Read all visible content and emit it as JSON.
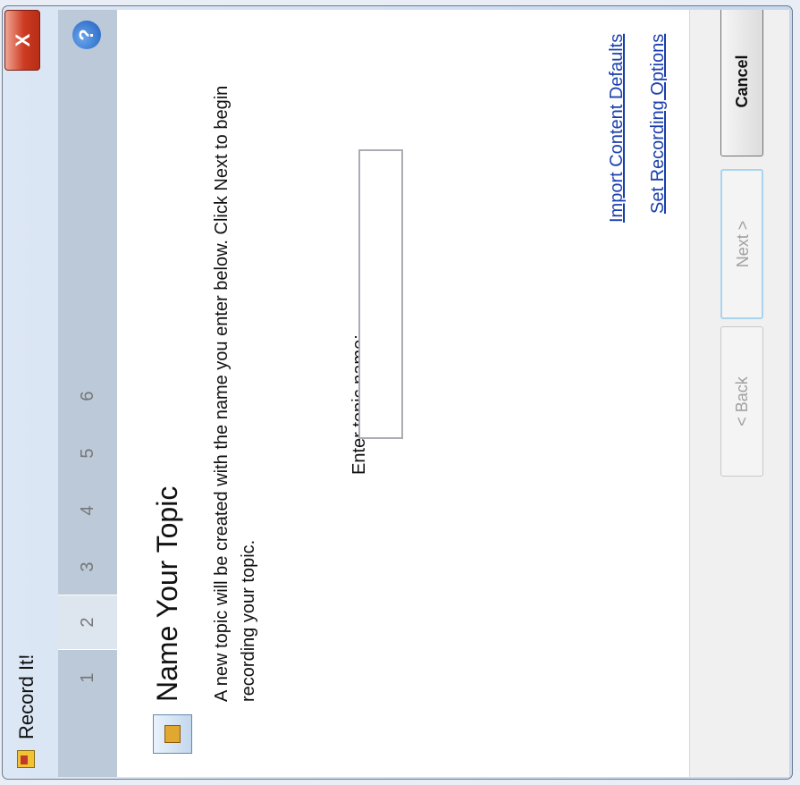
{
  "window": {
    "title": "Record It!",
    "close_label": "X"
  },
  "steps": {
    "items": [
      "1",
      "2",
      "3",
      "4",
      "5",
      "6"
    ],
    "selected": "2",
    "help_label": "?"
  },
  "page": {
    "heading": "Name Your Topic",
    "description": "A new topic will be created with the name you enter below. Click Next to begin recording your topic.",
    "topic_label": "Enter topic name:",
    "topic_value": ""
  },
  "links": {
    "import_defaults": "Import Content Defaults",
    "set_recording": "Set Recording Options"
  },
  "buttons": {
    "back": "< Back",
    "next": "Next >",
    "cancel": "Cancel"
  },
  "icons": {
    "title": "record-it-icon",
    "wizard": "topic-wizard-icon",
    "help": "help-icon",
    "close": "close-icon"
  }
}
